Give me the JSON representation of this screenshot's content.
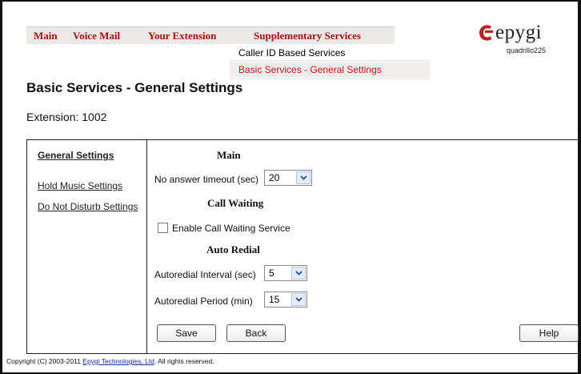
{
  "menu": {
    "items": [
      {
        "label": "Main"
      },
      {
        "label": "Voice Mail"
      },
      {
        "label": "Your Extension"
      },
      {
        "label": "Supplementary Services"
      }
    ],
    "dropdown": [
      {
        "label": "Caller ID Based Services"
      },
      {
        "label": "Basic Services - General Settings"
      }
    ]
  },
  "brand": {
    "logo_text": "epygi",
    "device_name": "quadrillo225",
    "logo_color": "#c0201a"
  },
  "page": {
    "title": "Basic Services - General Settings",
    "extension": "Extension: 1002"
  },
  "sidebar": {
    "items": [
      {
        "label": "General Settings",
        "active": true
      },
      {
        "label": "Hold Music Settings"
      },
      {
        "label": "Do Not Disturb Settings"
      }
    ]
  },
  "form": {
    "main_title": "Main",
    "no_answer_label": "No answer timeout (sec)",
    "no_answer_value": "20",
    "call_waiting_title": "Call Waiting",
    "enable_cw_label": "Enable Call Waiting Service",
    "enable_cw_checked": false,
    "auto_redial_title": "Auto Redial",
    "redial_interval_label": "Autoredial Interval (sec)",
    "redial_interval_value": "5",
    "redial_period_label": "Autoredial Period (min)",
    "redial_period_value": "15"
  },
  "buttons": {
    "save": "Save",
    "back": "Back",
    "help": "Help"
  },
  "footer": {
    "prefix": "Copyright (C) 2003-2011 ",
    "link": "Epygi Technologies, Ltd",
    "suffix": ". All rights reserved."
  },
  "colors": {
    "menu_text": "#a01010",
    "menu_bg": "#eceae6",
    "dropdown_active": "#c01818",
    "arrow_bg": "#e3ecfa"
  }
}
